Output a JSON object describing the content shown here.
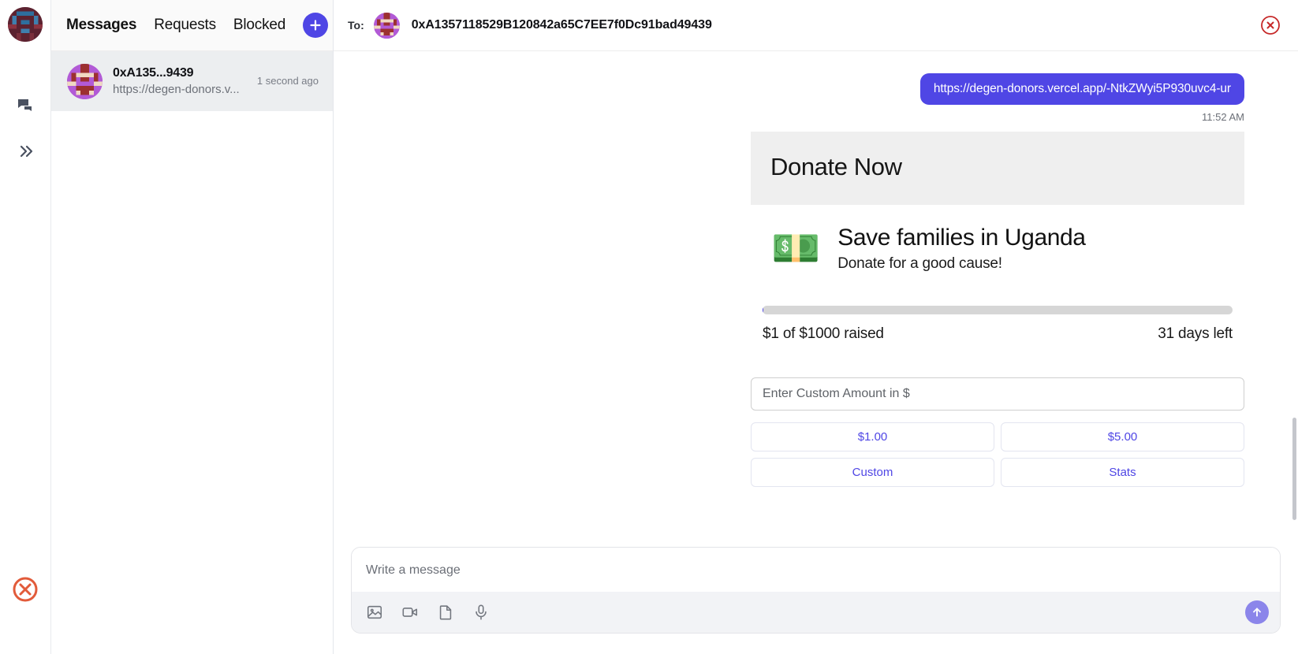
{
  "rail": {
    "avatar_name": "user-blockie-avatar",
    "chat_icon": "chat-bubbles-icon",
    "expand_icon": "double-chevron-right-icon",
    "logo": "xmtp-circle-x-logo"
  },
  "sidebar": {
    "tabs": [
      {
        "label": "Messages",
        "active": true
      },
      {
        "label": "Requests",
        "active": false
      },
      {
        "label": "Blocked",
        "active": false
      }
    ],
    "add_button": "plus-icon",
    "conversations": [
      {
        "title": "0xA135...9439",
        "preview": "https://degen-donors.v...",
        "time": "1 second ago"
      }
    ]
  },
  "header": {
    "to_label": "To:",
    "address": "0xA1357118529B120842a65C7EE7f0Dc91bad49439",
    "close_icon": "close-circle-icon",
    "close_color": "#c62828"
  },
  "thread": {
    "messages": [
      {
        "text": "https://degen-donors.vercel.app/-NtkZWyi5P930uvc4-ur",
        "time": "11:52 AM",
        "outgoing": true,
        "bubble_color": "#4f46e5"
      }
    ]
  },
  "frame": {
    "title": "Donate Now",
    "emoji": "💵",
    "cause_title": "Save families in Uganda",
    "cause_subtitle": "Donate for a good cause!",
    "progress_percent": 0.1,
    "raised_text": "$1 of $1000 raised",
    "days_left_text": "31 days left",
    "amount_placeholder": "Enter Custom Amount in $",
    "amount_value": "",
    "buttons": [
      {
        "label": "$1.00"
      },
      {
        "label": "$5.00"
      },
      {
        "label": "Custom"
      },
      {
        "label": "Stats"
      }
    ],
    "accent_color": "#4f46e5"
  },
  "composer": {
    "placeholder": "Write a message",
    "value": "",
    "tools": [
      {
        "name": "image-icon"
      },
      {
        "name": "video-camera-icon"
      },
      {
        "name": "document-icon"
      },
      {
        "name": "microphone-icon"
      }
    ],
    "send_icon": "arrow-up-icon",
    "send_color": "#8b85ea"
  }
}
